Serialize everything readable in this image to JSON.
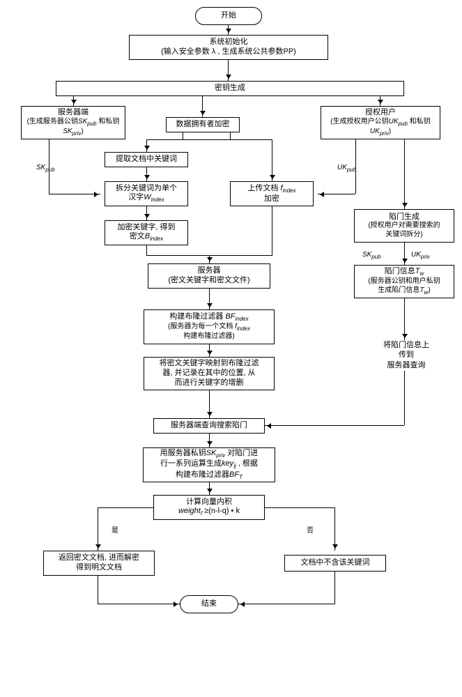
{
  "terminators": {
    "start": "开始",
    "end": "结束"
  },
  "nodes": {
    "init_title": "系统初始化",
    "init_sub": "(输入安全参数 λ , 生成系统公共参数PP)",
    "keygen": "密钥生成",
    "server_side_t": "服务器端",
    "server_side_s": "(生成服务器公钥SKpub 和私钥SKpriv)",
    "auth_user_t": "授权用户",
    "auth_user_s": "(生成授权用户公钥UKpub 和私钥UKpriv)",
    "owner_enc": "数据拥有者加密",
    "extract_kw": "提取文档中关键词",
    "split_kw_t": "拆分关键词为单个",
    "split_kw_s": "汉字Windex",
    "enc_kw_t": "加密关键字, 得到",
    "enc_kw_s": "密文Bindex",
    "upload_doc_t": "上传文档 findex",
    "upload_doc_s": "加密",
    "server_t": "服务器",
    "server_s": "(密文关键字和密文文件)",
    "build_bf_t": "构建布隆过滤器  BFindex",
    "build_bf_s1": "(服务器为每一个文档 findex",
    "build_bf_s2": "构建布隆过滤器)",
    "map_bf_1": "将密文关键字映射到布隆过滤",
    "map_bf_2": "器, 并记录在其中的位置, 从",
    "map_bf_3": "而进行关键字的增删",
    "trap_gen_t": "陷门生成",
    "trap_gen_s1": "(授权用户对需要搜索的",
    "trap_gen_s2": "关键词拆分)",
    "trap_info_t": "陷门信息Tw",
    "trap_info_s1": "(服务器公钥和用户私钥",
    "trap_info_s2": "生成陷门信息Tw)",
    "upload_trap_1": "将陷门信息上",
    "upload_trap_2": "传到",
    "upload_trap_3": "服务器查询",
    "server_query": "服务器端查询搜索陷门",
    "priv_op_1": "用服务器私钥SKpriv 对陷门进",
    "priv_op_2": "行一系列运算生成keyij , 根据",
    "priv_op_3": "构建布隆过滤器BFT",
    "calc_t": "计算向量内积",
    "calc_s": "weightf ≥(n-l-q) • k",
    "ret_doc_1": "返回密文文档, 进而解密",
    "ret_doc_2": "得到明文文档",
    "no_kw": "文档中不含该关键词"
  },
  "edge_labels": {
    "SKpub": "SKpub",
    "UKpub": "UKpub",
    "SKpub2": "SKpub",
    "UKpriv": "UKpriv",
    "yes": "是",
    "no": "否"
  }
}
